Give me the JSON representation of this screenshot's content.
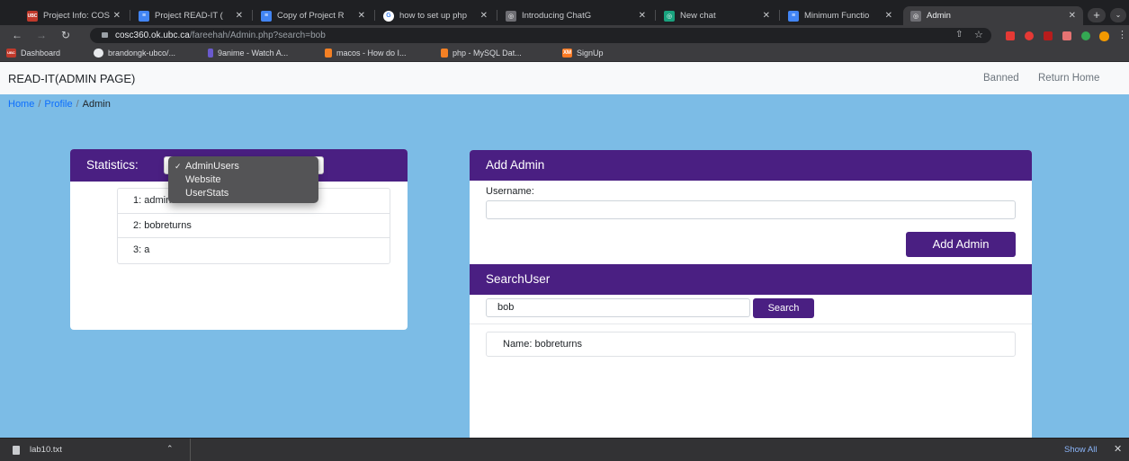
{
  "browser": {
    "tabs": [
      {
        "label": "Project Info: COSC",
        "favicon": "UBC",
        "favicon_color": "#c0392b"
      },
      {
        "label": "Project READ-IT (",
        "favicon": "≡",
        "favicon_color": "#4285f4"
      },
      {
        "label": "Copy of Project R",
        "favicon": "≡",
        "favicon_color": "#4285f4"
      },
      {
        "label": "how to set up php",
        "favicon": "G",
        "favicon_color": "#4285f4"
      },
      {
        "label": "Introducing ChatG",
        "favicon": "◎",
        "favicon_color": "#6e6e73"
      },
      {
        "label": "New chat",
        "favicon": "◎",
        "favicon_color": "#19a27e"
      },
      {
        "label": "Minimum Functio",
        "favicon": "≡",
        "favicon_color": "#4285f4"
      },
      {
        "label": "Admin",
        "favicon": "◎",
        "favicon_color": "#6e6e73"
      }
    ],
    "new_tab": "+",
    "tab_menu": "⌄",
    "url_host": "cosc360.ok.ubc.ca",
    "url_path": "/fareehah/Admin.php?search=bob",
    "bookmarks": [
      {
        "label": "Dashboard",
        "favicon": "UBC",
        "favicon_color": "#c0392b"
      },
      {
        "label": "brandongk-ubco/...",
        "favicon": "",
        "favicon_color": "#e8eaed"
      },
      {
        "label": "9anime - Watch A...",
        "favicon": "",
        "favicon_color": "#6a5acd"
      },
      {
        "label": "macos - How do I...",
        "favicon": "",
        "favicon_color": "#f48024"
      },
      {
        "label": "php - MySQL Dat...",
        "favicon": "",
        "favicon_color": "#f48024"
      },
      {
        "label": "SignUp",
        "favicon": "XM",
        "favicon_color": "#fb7a24"
      }
    ]
  },
  "page": {
    "brand": "READ-IT(ADMIN PAGE)",
    "nav": {
      "banned": "Banned",
      "return_home": "Return Home"
    },
    "breadcrumb": {
      "home": "Home",
      "sep": "/",
      "profile": "Profile",
      "current": "Admin"
    },
    "statistics": {
      "title": "Statistics:",
      "options": [
        "AdminUsers",
        "Website",
        "UserStats"
      ],
      "selected_check": "✓",
      "rows": [
        "1: admin",
        "2: bobreturns",
        "3: a"
      ]
    },
    "add_admin": {
      "title": "Add Admin",
      "username_label": "Username:",
      "username_value": "",
      "button": "Add Admin"
    },
    "search_user": {
      "title": "SearchUser",
      "query": "bob",
      "button": "Search",
      "result": "Name: bobreturns"
    }
  },
  "download_shelf": {
    "file": "lab10.txt",
    "show_all": "Show All",
    "close": "✕"
  },
  "colors": {
    "page_bg": "#7cbce6",
    "card_header": "#4a1f82",
    "link": "#0d6efd"
  }
}
